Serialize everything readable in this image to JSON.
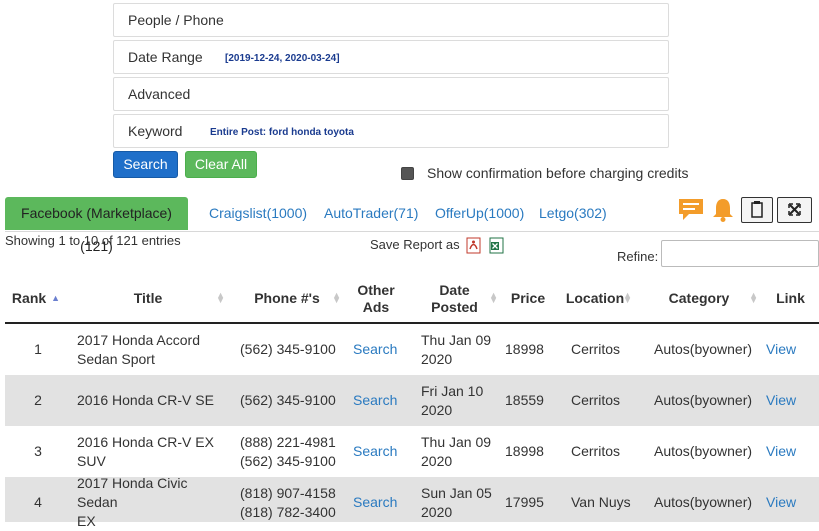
{
  "filters": {
    "people_phone": {
      "label": "People / Phone"
    },
    "date_range": {
      "label": "Date Range",
      "value": "[2019-12-24, 2020-03-24]"
    },
    "advanced": {
      "label": "Advanced"
    },
    "keyword": {
      "label": "Keyword",
      "value": "Entire Post: ford honda toyota"
    }
  },
  "buttons": {
    "search": "Search",
    "clear_all": "Clear All"
  },
  "confirm": {
    "label": "Show confirmation before charging credits",
    "checked": true
  },
  "tabs": [
    {
      "label": "Facebook (Marketplace)(121)",
      "active": true
    },
    {
      "label": "Craigslist(1000)"
    },
    {
      "label": "AutoTrader(71)"
    },
    {
      "label": "OfferUp(1000)"
    },
    {
      "label": "Letgo(302)"
    }
  ],
  "toolbar_icons": [
    "comment-icon",
    "bell-icon",
    "clipboard-icon",
    "fullscreen-icon"
  ],
  "colors": {
    "active_tab": "#5cb85c",
    "link": "#2a7ac0",
    "search_button": "#1f6fc9",
    "clear_button": "#5cb85c",
    "alert_orange": "#f39c2a"
  },
  "info": {
    "showing": "Showing 1 to 10 of 121 entries",
    "save_report": "Save Report as",
    "refine": "Refine:"
  },
  "table": {
    "headers": {
      "rank": "Rank",
      "title": "Title",
      "phone": "Phone #'s",
      "other_ads_1": "Other",
      "other_ads_2": "Ads",
      "date_1": "Date",
      "date_2": "Posted",
      "price": "Price",
      "location": "Location",
      "category": "Category",
      "link": "Link"
    },
    "rows": [
      {
        "rank": "1",
        "title1": "2017 Honda Accord",
        "title2": "Sedan Sport",
        "phone1": "(562) 345-9100",
        "phone2": "",
        "other_ads": "Search",
        "date1": "Thu Jan 09",
        "date2": "2020",
        "price": "18998",
        "location": "Cerritos",
        "category": "Autos(byowner)",
        "link": "View"
      },
      {
        "rank": "2",
        "title1": "2016 Honda CR-V SE",
        "title2": "",
        "phone1": "(562) 345-9100",
        "phone2": "",
        "other_ads": "Search",
        "date1": "Fri Jan 10",
        "date2": "2020",
        "price": "18559",
        "location": "Cerritos",
        "category": "Autos(byowner)",
        "link": "View"
      },
      {
        "rank": "3",
        "title1": "2016 Honda CR-V EX",
        "title2": "SUV",
        "phone1": "(888) 221-4981",
        "phone2": "(562) 345-9100",
        "other_ads": "Search",
        "date1": "Thu Jan 09",
        "date2": "2020",
        "price": "18998",
        "location": "Cerritos",
        "category": "Autos(byowner)",
        "link": "View"
      },
      {
        "rank": "4",
        "title1": "2017 Honda Civic Sedan",
        "title2": "EX",
        "phone1": "(818) 907-4158",
        "phone2": "(818) 782-3400",
        "other_ads": "Search",
        "date1": "Sun Jan 05",
        "date2": "2020",
        "price": "17995",
        "location": "Van Nuys",
        "category": "Autos(byowner)",
        "link": "View"
      }
    ]
  }
}
